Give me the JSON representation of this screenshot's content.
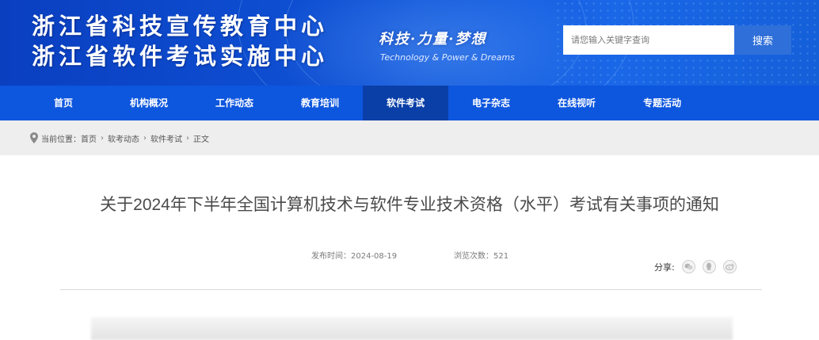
{
  "header": {
    "title_line1": "浙江省科技宣传教育中心",
    "title_line2": "浙江省软件考试实施中心",
    "slogan": "科技·力量·梦想",
    "slogan_en": "Technology & Power & Dreams",
    "search_placeholder": "请您输入关键字查询",
    "search_button": "搜索"
  },
  "nav": {
    "items": [
      "首页",
      "机构概况",
      "工作动态",
      "教育培训",
      "软件考试",
      "电子杂志",
      "在线视听",
      "专题活动"
    ],
    "active": "软件考试"
  },
  "breadcrumb": {
    "label": "当前位置：",
    "items": [
      "首页",
      "软考动态",
      "软件考试",
      "正文"
    ],
    "separator": "›"
  },
  "article": {
    "title": "关于2024年下半年全国计算机技术与软件专业技术资格（水平）考试有关事项的通知",
    "publish_label": "发布时间：",
    "publish_date": "2024-08-19",
    "views_label": "浏览次数：",
    "views": "521",
    "share_label": "分享:"
  },
  "colors": {
    "header_blue": "#0f52d6",
    "nav_blue": "#0d56de",
    "nav_active": "#0a3fa8",
    "search_button": "#2f6fd9"
  }
}
